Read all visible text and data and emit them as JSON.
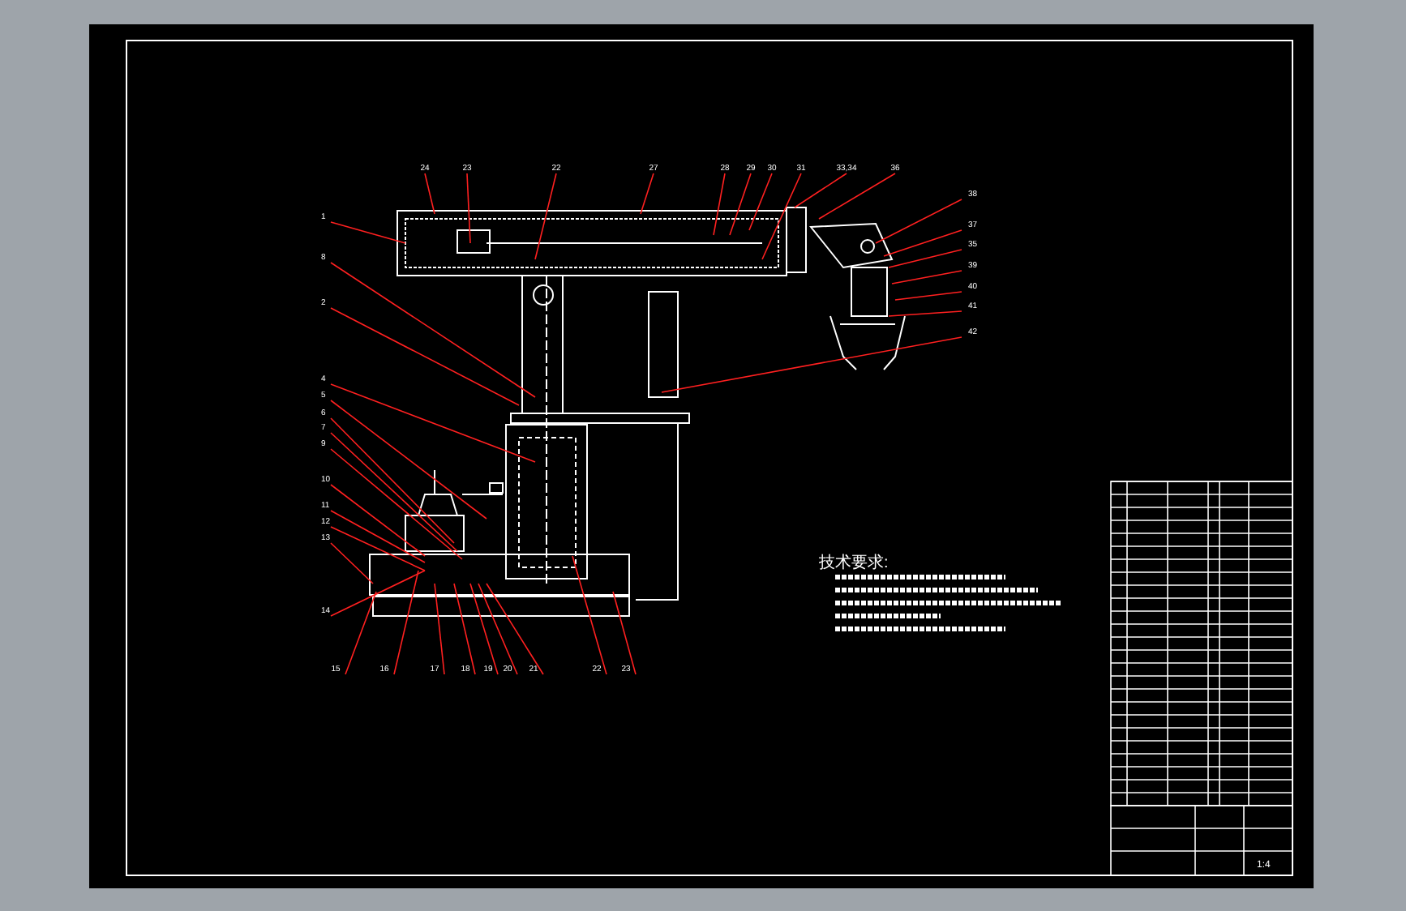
{
  "drawing": {
    "notes_heading": "技术要求:",
    "part_labels": [
      {
        "text": "24"
      },
      {
        "text": "23"
      },
      {
        "text": "22"
      },
      {
        "text": "27"
      },
      {
        "text": "28"
      },
      {
        "text": "29"
      },
      {
        "text": "30"
      },
      {
        "text": "31"
      },
      {
        "text": "33,34"
      },
      {
        "text": "36"
      },
      {
        "text": "38"
      },
      {
        "text": "37"
      },
      {
        "text": "35"
      },
      {
        "text": "39"
      },
      {
        "text": "40"
      },
      {
        "text": "41"
      },
      {
        "text": "42"
      },
      {
        "text": "1"
      },
      {
        "text": "8"
      },
      {
        "text": "2"
      },
      {
        "text": "4"
      },
      {
        "text": "5"
      },
      {
        "text": "6"
      },
      {
        "text": "7"
      },
      {
        "text": "9"
      },
      {
        "text": "10"
      },
      {
        "text": "11"
      },
      {
        "text": "12"
      },
      {
        "text": "13"
      },
      {
        "text": "14"
      },
      {
        "text": "15"
      },
      {
        "text": "16"
      },
      {
        "text": "17"
      },
      {
        "text": "18"
      },
      {
        "text": "19"
      },
      {
        "text": "20"
      },
      {
        "text": "21"
      },
      {
        "text": "22"
      },
      {
        "text": "23"
      }
    ],
    "scale": "1:4"
  }
}
